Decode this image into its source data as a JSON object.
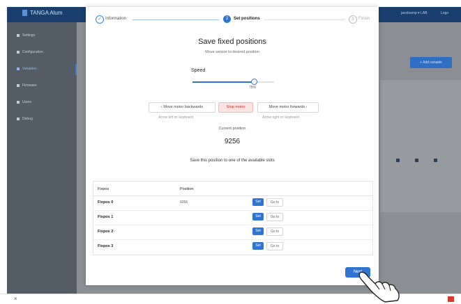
{
  "app": {
    "title": "TANGA Alum",
    "user_menu": "jacobsonp ▾  LAB",
    "logout": "Logo"
  },
  "sidebar": {
    "items": [
      {
        "label": "Settings",
        "icon": "gear-icon"
      },
      {
        "label": "Configuration",
        "icon": "sliders-icon"
      },
      {
        "label": "Variables",
        "icon": "list-icon",
        "active": true
      },
      {
        "label": "Firmware",
        "icon": "chip-icon"
      },
      {
        "label": "Users",
        "icon": "user-icon"
      },
      {
        "label": "Debug",
        "icon": "bug-icon"
      }
    ]
  },
  "background": {
    "add_button": "+ Add variable"
  },
  "wizard": {
    "steps": [
      {
        "number": "✓",
        "label": "Information",
        "state": "done"
      },
      {
        "number": "2",
        "label": "Set positions",
        "state": "active"
      },
      {
        "number": "3",
        "label": "Finish",
        "state": "pending"
      }
    ],
    "title": "Save fixed positions",
    "subtitle": "Move sensor to desired position",
    "speed": {
      "label": "Speed",
      "value_text": "75%",
      "value": 0.75
    },
    "buttons": {
      "backward": "‹ Move motor backwards",
      "stop": "Stop motor",
      "forward": "Move motor forwards ›",
      "next": "Next"
    },
    "hints": {
      "left": "Arrow left on keyboard",
      "right": "Arrow right on keyboard"
    },
    "current_position": {
      "label": "Current position",
      "value": "9256"
    },
    "save_note": "Save this position to one of the available slots",
    "table": {
      "headers": [
        "Fixpos",
        "Position"
      ],
      "rows": [
        {
          "name": "Fixpos 0",
          "position": "9256",
          "set": "Set",
          "goto": "Go to"
        },
        {
          "name": "Fixpos 1",
          "position": "",
          "set": "Set",
          "goto": "Go to"
        },
        {
          "name": "Fixpos 2",
          "position": "",
          "set": "Set",
          "goto": "Go to"
        },
        {
          "name": "Fixpos 3",
          "position": "",
          "set": "Set",
          "goto": "Go to"
        }
      ]
    }
  },
  "colors": {
    "accent": "#2f74d0",
    "stop": "#c9302c",
    "topbar": "#1a3f6e"
  }
}
